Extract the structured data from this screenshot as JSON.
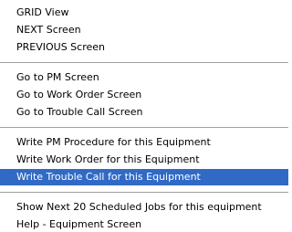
{
  "menu": {
    "groups": [
      {
        "items": [
          {
            "label": "GRID View"
          },
          {
            "label": "NEXT Screen"
          },
          {
            "label": "PREVIOUS Screen"
          }
        ]
      },
      {
        "items": [
          {
            "label": "Go to PM Screen"
          },
          {
            "label": "Go to Work Order Screen"
          },
          {
            "label": "Go to Trouble Call Screen"
          }
        ]
      },
      {
        "items": [
          {
            "label": "Write PM Procedure for this Equipment"
          },
          {
            "label": "Write Work Order for this Equipment"
          },
          {
            "label": "Write Trouble Call for this Equipment",
            "highlighted": true
          }
        ]
      },
      {
        "items": [
          {
            "label": "Show Next 20 Scheduled Jobs for this equipment"
          },
          {
            "label": "Help - Equipment Screen"
          }
        ]
      }
    ],
    "colors": {
      "highlight_bg": "#316ac5",
      "highlight_text": "#ffffff",
      "separator": "#a0a0a0"
    }
  }
}
